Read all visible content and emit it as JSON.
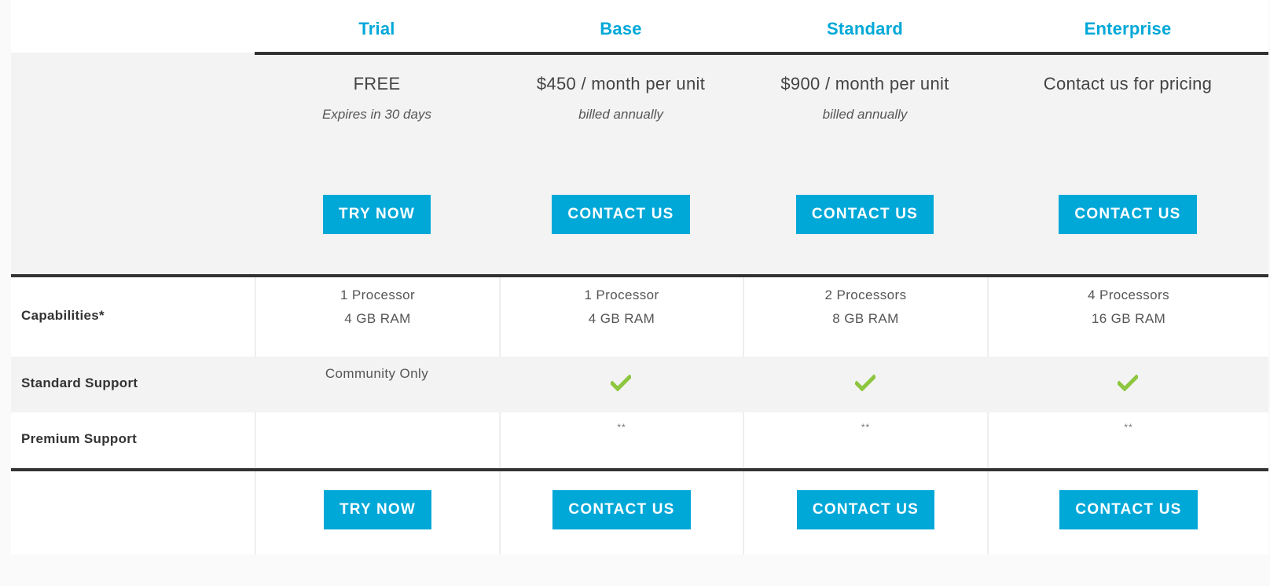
{
  "plans": [
    {
      "name": "Trial",
      "price": "FREE",
      "price_note": "Expires in 30 days",
      "cta": "TRY NOW",
      "capabilities": [
        "1 Processor",
        "4 GB RAM"
      ],
      "standard_support": {
        "type": "text",
        "value": "Community Only"
      },
      "premium_support": ""
    },
    {
      "name": "Base",
      "price": "$450 / month per unit",
      "price_note": "billed annually",
      "cta": "CONTACT US",
      "capabilities": [
        "1 Processor",
        "4 GB RAM"
      ],
      "standard_support": {
        "type": "check",
        "icon": "checkmark-icon"
      },
      "premium_support": "**"
    },
    {
      "name": "Standard",
      "price": "$900 / month per unit",
      "price_note": "billed annually",
      "cta": "CONTACT US",
      "capabilities": [
        "2 Processors",
        "8 GB RAM"
      ],
      "standard_support": {
        "type": "check",
        "icon": "checkmark-icon"
      },
      "premium_support": "**"
    },
    {
      "name": "Enterprise",
      "price": "Contact us for pricing",
      "price_note": "",
      "cta": "CONTACT US",
      "capabilities": [
        "4 Processors",
        "16 GB RAM"
      ],
      "standard_support": {
        "type": "check",
        "icon": "checkmark-icon"
      },
      "premium_support": "**"
    }
  ],
  "features": {
    "capabilities_label": "Capabilities*",
    "standard_support_label": "Standard Support",
    "premium_support_label": "Premium Support"
  },
  "colors": {
    "accent": "#00a8d8",
    "check": "#8dc63f",
    "rule": "#333333",
    "band": "#f3f3f3"
  }
}
